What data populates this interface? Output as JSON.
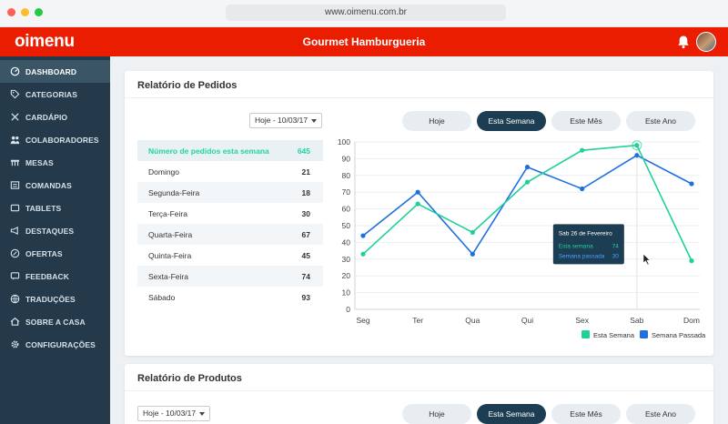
{
  "browser": {
    "url": "www.oimenu.com.br"
  },
  "header": {
    "logo": "oimenu",
    "title": "Gourmet Hamburgueria"
  },
  "sidebar": {
    "items": [
      {
        "label": "DASHBOARD",
        "icon": "dashboard-icon",
        "active": true
      },
      {
        "label": "CATEGORIAS",
        "icon": "tag-icon"
      },
      {
        "label": "CARDÁPIO",
        "icon": "utensils-icon"
      },
      {
        "label": "COLABORADORES",
        "icon": "people-icon"
      },
      {
        "label": "MESAS",
        "icon": "table-icon"
      },
      {
        "label": "COMANDAS",
        "icon": "receipt-icon"
      },
      {
        "label": "TABLETS",
        "icon": "tablet-icon"
      },
      {
        "label": "DESTAQUES",
        "icon": "megaphone-icon"
      },
      {
        "label": "OFERTAS",
        "icon": "percent-icon"
      },
      {
        "label": "FEEDBACK",
        "icon": "chat-icon"
      },
      {
        "label": "TRADUÇÕES",
        "icon": "globe-icon"
      },
      {
        "label": "SOBRE A CASA",
        "icon": "home-icon"
      },
      {
        "label": "CONFIGURAÇÕES",
        "icon": "gear-icon"
      }
    ]
  },
  "orders_report": {
    "title": "Relatório de Pedidos",
    "date_select": "Hoje - 10/03/17",
    "tabs": [
      "Hoje",
      "Esta Semana",
      "Este Mês",
      "Este Ano"
    ],
    "active_tab": "Esta Semana",
    "table": {
      "header_label": "Número de pedidos esta semana",
      "header_value": "645",
      "rows": [
        {
          "day": "Domingo",
          "value": "21"
        },
        {
          "day": "Segunda-Feira",
          "value": "18"
        },
        {
          "day": "Terça-Feira",
          "value": "30"
        },
        {
          "day": "Quarta-Feira",
          "value": "67"
        },
        {
          "day": "Quinta-Feira",
          "value": "45"
        },
        {
          "day": "Sexta-Feira",
          "value": "74"
        },
        {
          "day": "Sábado",
          "value": "93"
        }
      ]
    },
    "tooltip": {
      "title": "Sab 26 de Fevereiro",
      "rows": [
        {
          "label": "Esta semana",
          "value": "74"
        },
        {
          "label": "Semana passada",
          "value": "30"
        }
      ]
    }
  },
  "products_report": {
    "title": "Relatório de Produtos",
    "date_select": "Hoje - 10/03/17",
    "tabs": [
      "Hoje",
      "Esta Semana",
      "Este Mês",
      "Este Ano"
    ],
    "active_tab": "Esta Semana"
  },
  "colors": {
    "brand_red": "#ea1d00",
    "sidebar": "#243a4a",
    "this_week": "#1ed19a",
    "last_week": "#1f6fe0",
    "active_tab": "#1d3e52"
  },
  "chart_data": {
    "type": "line",
    "categories": [
      "Seg",
      "Ter",
      "Qua",
      "Qui",
      "Sex",
      "Sab",
      "Dom"
    ],
    "series": [
      {
        "name": "Esta Semana",
        "values": [
          33,
          63,
          46,
          76,
          95,
          98,
          29
        ]
      },
      {
        "name": "Semana Passada",
        "values": [
          44,
          70,
          33,
          85,
          72,
          92,
          75
        ]
      }
    ],
    "ylim": [
      0,
      100
    ],
    "yticks": [
      0,
      10,
      20,
      30,
      40,
      50,
      60,
      70,
      80,
      90,
      100
    ],
    "grid": true,
    "legend": "bottom-right",
    "highlight_category": "Sab"
  }
}
